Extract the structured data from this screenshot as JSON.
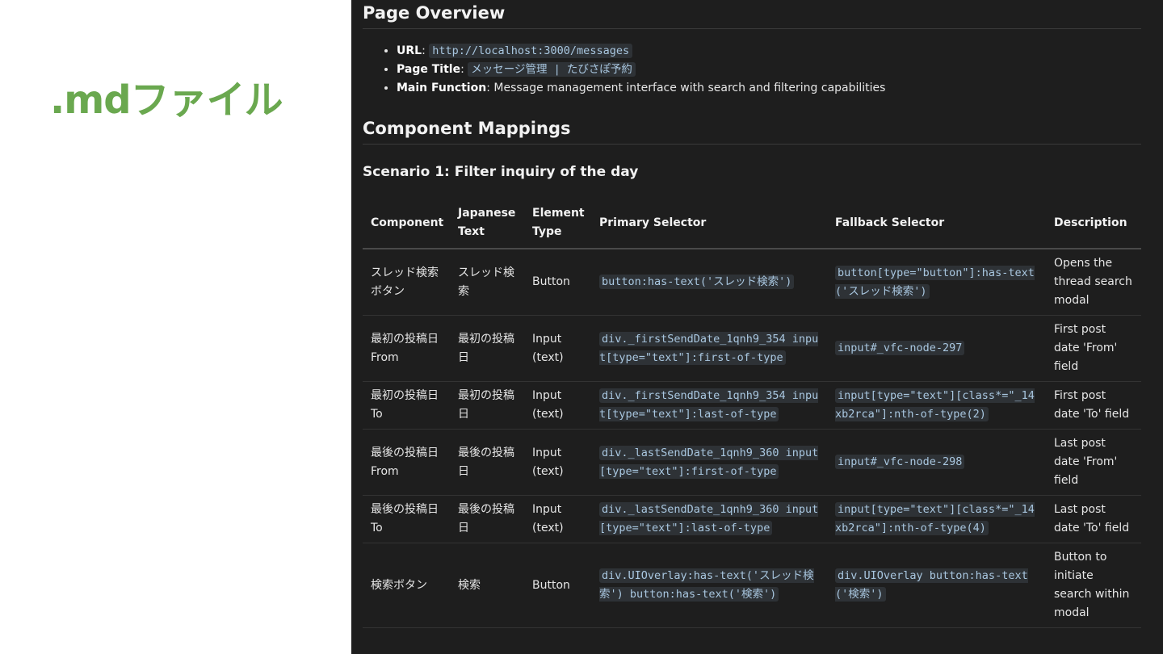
{
  "slide_label": ".mdファイル",
  "overview": {
    "heading": "Page Overview",
    "items": [
      {
        "key": "URL",
        "sep": ": ",
        "code": "http://localhost:3000/messages",
        "text": ""
      },
      {
        "key": "Page Title",
        "sep": ": ",
        "code": "メッセージ管理 | たびさぽ予約",
        "text": ""
      },
      {
        "key": "Main Function",
        "sep": ": ",
        "code": "",
        "text": "Message management interface with search and filtering capabilities"
      }
    ]
  },
  "mappings": {
    "heading": "Component Mappings",
    "scenario_title": "Scenario 1: Filter inquiry of the day",
    "columns": [
      "Component",
      "Japanese Text",
      "Element Type",
      "Primary Selector",
      "Fallback Selector",
      "Description"
    ],
    "rows": [
      {
        "component": "スレッド検索ボタン",
        "japanese": "スレッド検索",
        "type": "Button",
        "primary": "button:has-text('スレッド検索')",
        "fallback": "button[type=\"button\"]:has-text('スレッド検索')",
        "description": "Opens the thread search modal"
      },
      {
        "component": "最初の投稿日From",
        "japanese": "最初の投稿日",
        "type": "Input (text)",
        "primary": "div._firstSendDate_1qnh9_354 input[type=\"text\"]:first-of-type",
        "fallback": "input#_vfc-node-297",
        "description": "First post date 'From' field"
      },
      {
        "component": "最初の投稿日To",
        "japanese": "最初の投稿日",
        "type": "Input (text)",
        "primary": "div._firstSendDate_1qnh9_354 input[type=\"text\"]:last-of-type",
        "fallback": "input[type=\"text\"][class*=\"_14xb2rca\"]:nth-of-type(2)",
        "description": "First post date 'To' field"
      },
      {
        "component": "最後の投稿日From",
        "japanese": "最後の投稿日",
        "type": "Input (text)",
        "primary": "div._lastSendDate_1qnh9_360 input[type=\"text\"]:first-of-type",
        "fallback": "input#_vfc-node-298",
        "description": "Last post date 'From' field"
      },
      {
        "component": "最後の投稿日To",
        "japanese": "最後の投稿日",
        "type": "Input (text)",
        "primary": "div._lastSendDate_1qnh9_360 input[type=\"text\"]:last-of-type",
        "fallback": "input[type=\"text\"][class*=\"_14xb2rca\"]:nth-of-type(4)",
        "description": "Last post date 'To' field"
      },
      {
        "component": "検索ボタン",
        "japanese": "検索",
        "type": "Button",
        "primary": "div.UIOverlay:has-text('スレッド検索') button:has-text('検索')",
        "fallback": "div.UIOverlay button:has-text('検索')",
        "description": "Button to initiate search within modal"
      }
    ]
  },
  "colors": {
    "label_green": "#6aa84f",
    "panel_bg": "#1e1e1e",
    "code_bg": "#2e3236",
    "code_fg": "#a9c7e0"
  }
}
